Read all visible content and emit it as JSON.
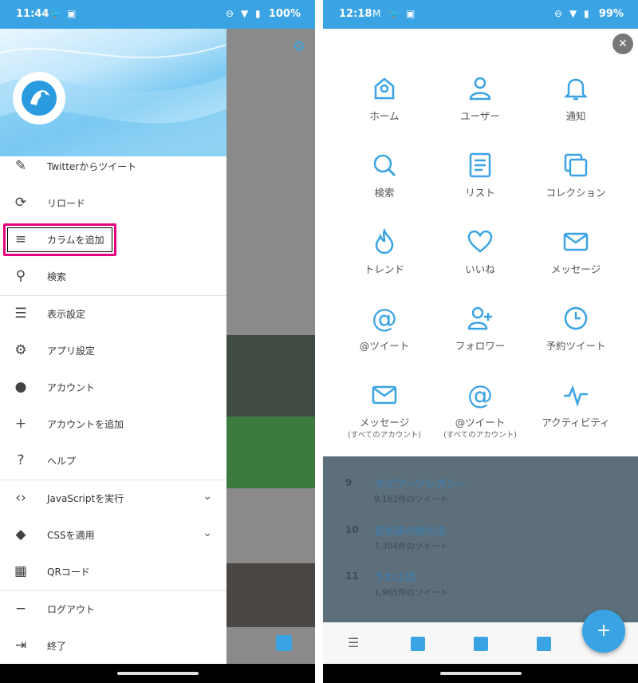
{
  "left": {
    "status": {
      "time": "11:44",
      "battery": "100%"
    },
    "drawer": {
      "items": [
        {
          "label": "Twitterからツイート",
          "icon": "edit-icon"
        },
        {
          "label": "リロード",
          "icon": "reload-icon"
        },
        {
          "label": "カラムを追加",
          "icon": "playlist-add-icon"
        },
        {
          "label": "検索",
          "icon": "search-icon"
        },
        {
          "label": "表示設定",
          "icon": "tune-icon"
        },
        {
          "label": "アプリ設定",
          "icon": "gear-icon"
        },
        {
          "label": "アカウント",
          "icon": "account-circle-icon"
        },
        {
          "label": "アカウントを追加",
          "icon": "person-add-icon"
        },
        {
          "label": "ヘルプ",
          "icon": "help-icon"
        },
        {
          "label": "JavaScriptを実行",
          "icon": "code-icon"
        },
        {
          "label": "CSSを適用",
          "icon": "style-icon"
        },
        {
          "label": "QRコード",
          "icon": "qr-code-icon"
        },
        {
          "label": "ログアウト",
          "icon": "person-remove-icon"
        },
        {
          "label": "終了",
          "icon": "exit-icon"
        }
      ]
    }
  },
  "right": {
    "status": {
      "time": "12:18",
      "battery": "99%"
    },
    "column_types": [
      {
        "label": "ホーム",
        "icon": "home-icon"
      },
      {
        "label": "ユーザー",
        "icon": "user-icon"
      },
      {
        "label": "通知",
        "icon": "bell-icon"
      },
      {
        "label": "検索",
        "icon": "search-icon"
      },
      {
        "label": "リスト",
        "icon": "list-icon"
      },
      {
        "label": "コレクション",
        "icon": "collection-icon"
      },
      {
        "label": "トレンド",
        "icon": "flame-icon"
      },
      {
        "label": "いいね",
        "icon": "heart-icon"
      },
      {
        "label": "メッセージ",
        "icon": "mail-icon"
      },
      {
        "label": "@ツイート",
        "icon": "at-icon"
      },
      {
        "label": "フォロワー",
        "icon": "follower-icon"
      },
      {
        "label": "予約ツイート",
        "icon": "clock-icon"
      },
      {
        "label": "メッセージ",
        "sub": "(すべてのアカウント)",
        "icon": "mail-icon"
      },
      {
        "label": "@ツイート",
        "sub": "(すべてのアカウント)",
        "icon": "at-icon"
      },
      {
        "label": "アクティビティ",
        "icon": "activity-icon"
      }
    ],
    "trends": [
      {
        "rank": "9",
        "title": "ホグワーツレガシー",
        "count": "9,162件のツイート"
      },
      {
        "rank": "10",
        "title": "長谷部の仮の主",
        "count": "7,304件のツイート"
      },
      {
        "rank": "11",
        "title": "うわさ話",
        "count": "1,965件のツイート"
      }
    ],
    "fab_label": "+"
  }
}
